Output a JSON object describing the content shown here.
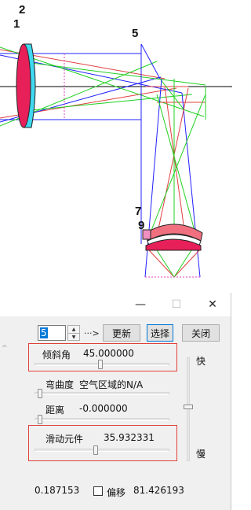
{
  "viewport": {
    "labels": [
      {
        "id": "label-2",
        "text": "2"
      },
      {
        "id": "label-1",
        "text": "1"
      },
      {
        "id": "label-5",
        "text": "5"
      },
      {
        "id": "label-7",
        "text": "7"
      },
      {
        "id": "label-9",
        "text": "9"
      }
    ],
    "colors": {
      "ray_blue": "#2020ff",
      "ray_red": "#e04040",
      "ray_green": "#20d020",
      "lens_magenta": "#e8205a",
      "lens_cyan": "#40d8f0",
      "dash_magenta": "#e040c0"
    }
  },
  "dialog": {
    "title_buttons": {
      "minimize": "—",
      "maximize": "☐",
      "close": "✕"
    },
    "spin_value": "5",
    "arrow_text": "···>",
    "buttons": {
      "update": "更新",
      "select": "选择",
      "close": "关闭"
    },
    "tilt_angle": {
      "label": "倾斜角",
      "value": "45.000000",
      "slider_fraction": 0.49
    },
    "curvature": {
      "label": "弯曲度",
      "value": "空气区域的N/A",
      "slider_fraction": 0.0
    },
    "distance": {
      "label": "距离",
      "value": "-0.000000",
      "slider_fraction": 0.0
    },
    "sliding_element": {
      "label": "滑动元件",
      "value": "35.932331",
      "slider_fraction": 0.45
    },
    "speed": {
      "fast": "快",
      "slow": "慢"
    },
    "bottom": {
      "left_value": "0.187153",
      "offset_label": "偏移",
      "offset_checked": false,
      "right_value": "81.426193"
    },
    "colors": {
      "frame_red": "#e0413a",
      "focus_blue": "#0078d7"
    }
  }
}
